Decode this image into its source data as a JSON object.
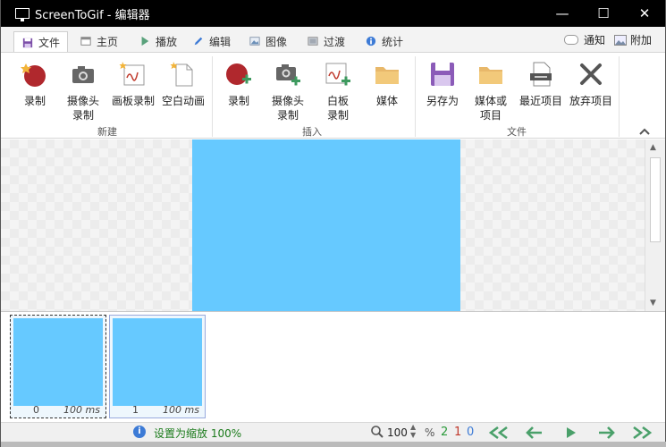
{
  "window": {
    "title": "ScreenToGif - 编辑器"
  },
  "title_controls": {
    "minimize": "—",
    "maximize": "☐",
    "close": "✕"
  },
  "tabs": [
    {
      "label": "文件",
      "icon": "save-disk-icon",
      "active": true
    },
    {
      "label": "主页",
      "icon": "home-window-icon"
    },
    {
      "label": "播放",
      "icon": "play-triangle-icon"
    },
    {
      "label": "编辑",
      "icon": "pencil-icon"
    },
    {
      "label": "图像",
      "icon": "image-icon"
    },
    {
      "label": "过渡",
      "icon": "transition-icon"
    },
    {
      "label": "统计",
      "icon": "info-icon"
    }
  ],
  "tab_right": {
    "notify": "通知",
    "attach": "附加"
  },
  "ribbon": {
    "groups": {
      "new": "新建",
      "insert": "插入",
      "file": "文件"
    },
    "new": {
      "record": "录制",
      "webcam": "摄像头\n录制",
      "board": "画板录制",
      "blank": "空白动画"
    },
    "insert": {
      "record": "录制",
      "webcam": "摄像头\n录制",
      "board": "白板\n录制",
      "media": "媒体"
    },
    "file": {
      "save_as": "另存为",
      "media_or_project": "媒体或\n项目",
      "recent": "最近项目",
      "discard": "放弃项目"
    }
  },
  "colors": {
    "frame_fill": "#66c9ff",
    "accent": "#3d7bd6"
  },
  "frames": [
    {
      "index": "0",
      "duration": "100 ms",
      "selected": true
    },
    {
      "index": "1",
      "duration": "100 ms",
      "selected": false
    }
  ],
  "status": {
    "message": "设置为缩放 100%",
    "zoom": "100",
    "pct": "%",
    "count_total": "2",
    "count_selected": "1",
    "count_current": "0"
  }
}
